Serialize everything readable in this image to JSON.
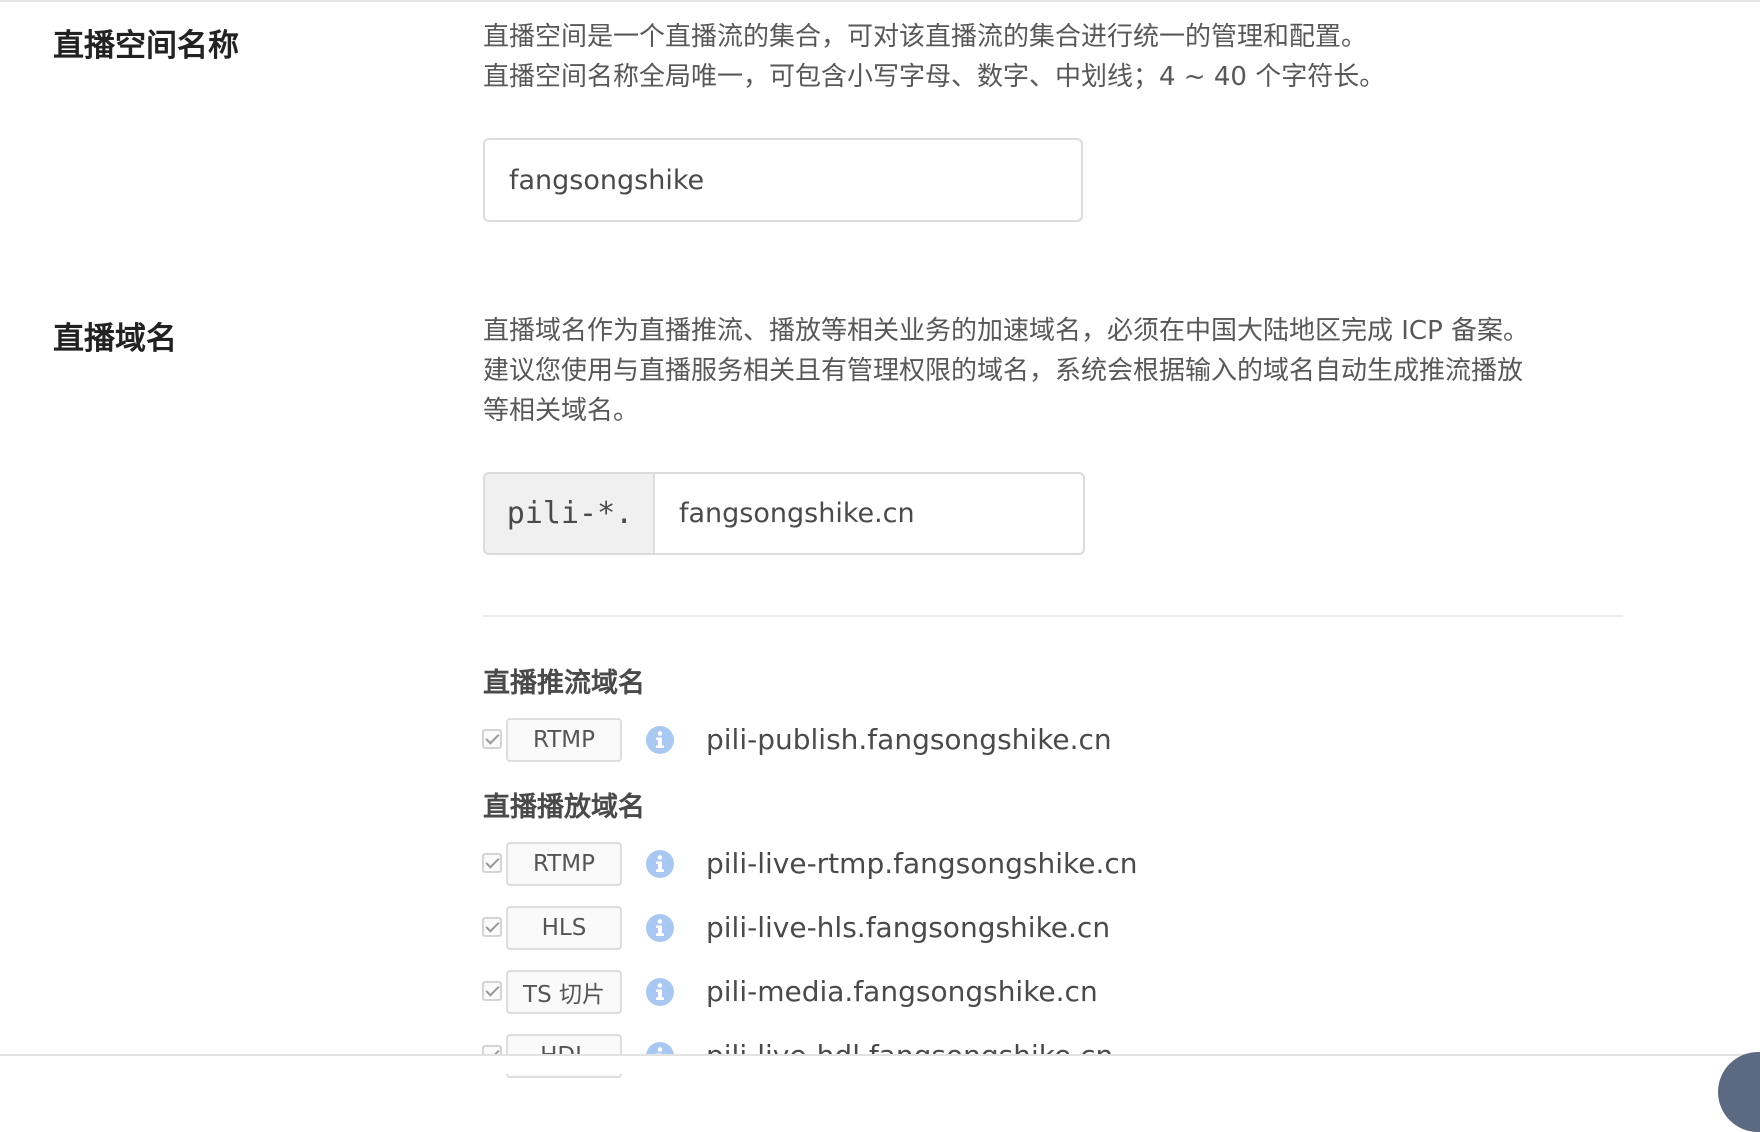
{
  "space_name_section": {
    "title": "直播空间名称",
    "desc_line1": "直播空间是一个直播流的集合，可对该直播流的集合进行统一的管理和配置。",
    "desc_line2": "直播空间名称全局唯一，可包含小写字母、数字、中划线；4 ~ 40 个字符长。",
    "input_value": "fangsongshike"
  },
  "domain_section": {
    "title": "直播域名",
    "desc_line1": "直播域名作为直播推流、播放等相关业务的加速域名，必须在中国大陆地区完成 ICP 备案。",
    "desc_line2": "建议您使用与直播服务相关且有管理权限的域名，系统会根据输入的域名自动生成推流播放",
    "desc_line3": "等相关域名。",
    "prefix": "pili-*.",
    "input_value": "fangsongshike.cn"
  },
  "publish_group": {
    "title": "直播推流域名",
    "items": [
      {
        "protocol": "RTMP",
        "domain": "pili-publish.fangsongshike.cn",
        "checked": true
      }
    ]
  },
  "play_group": {
    "title": "直播播放域名",
    "items": [
      {
        "protocol": "RTMP",
        "domain": "pili-live-rtmp.fangsongshike.cn",
        "checked": true
      },
      {
        "protocol": "HLS",
        "domain": "pili-live-hls.fangsongshike.cn",
        "checked": true
      },
      {
        "protocol": "TS 切片",
        "domain": "pili-media.fangsongshike.cn",
        "checked": true
      },
      {
        "protocol": "HDL",
        "domain": "pili-live-hdl.fangsongshike.cn",
        "checked": true
      }
    ]
  },
  "icons": {
    "info": "info-icon",
    "check": "checkmark-icon"
  },
  "colors": {
    "info_icon": "#a8c8f2",
    "title_text": "#222222",
    "body_text": "#585858"
  }
}
